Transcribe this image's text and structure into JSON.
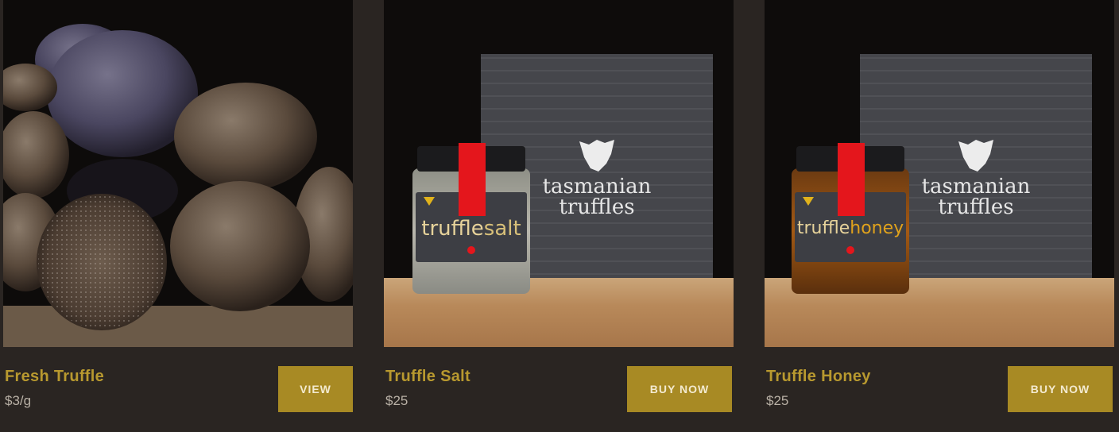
{
  "products": [
    {
      "title": "Fresh Truffle",
      "price": "$3/g",
      "button": "VIEW",
      "image": "fresh-truffles-photo"
    },
    {
      "title": "Truffle Salt",
      "price": "$25",
      "button": "BUY NOW",
      "image": "truffle-salt-jar-photo",
      "box_brand": [
        "tasmanian",
        "truffles"
      ],
      "jar_label": [
        "truffle",
        "salt"
      ]
    },
    {
      "title": "Truffle Honey",
      "price": "$25",
      "button": "BUY NOW",
      "image": "truffle-honey-jar-photo",
      "box_brand": [
        "tasmanian",
        "truffles"
      ],
      "jar_label": [
        "truffle",
        "honey"
      ]
    }
  ],
  "colors": {
    "background": "#2a2522",
    "accent": "#a88a24",
    "title": "#b8992f",
    "price": "#b9b1a6"
  }
}
